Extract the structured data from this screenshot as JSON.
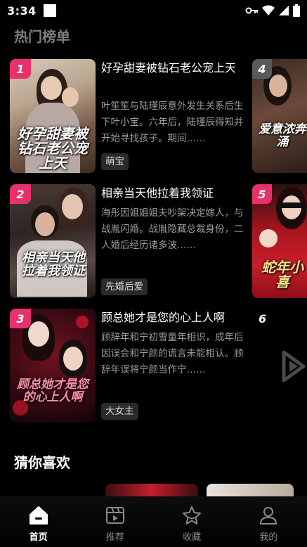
{
  "status_bar": {
    "time": "3:34"
  },
  "hot_section": {
    "title": "热门榜单"
  },
  "rank_items": [
    {
      "rank": "1",
      "title": "好孕甜妻被钻石老公宠上天",
      "description": "叶笙笙与陆瑾辰意外发生关系后生下叶小宝。六年后，陆瑾辰得知并开始寻找孩子。期间……",
      "tag": "萌宝",
      "poster_text": "好孕甜妻被钻石老公宠上天",
      "badge_color": "#e8316b"
    },
    {
      "rank": "2",
      "title": "相亲当天他拉着我领证",
      "description": "海彤因姐姐姐夫吵架决定嫁人，与战胤闪婚。战胤隐藏总裁身份，二人婚后经历诸多波……",
      "tag": "先婚后爱",
      "poster_text": "相亲当天他拉着我领证",
      "badge_color": "#e8316b"
    },
    {
      "rank": "3",
      "title": "顾总她才是您的心上人啊",
      "description": "顾辞年和宁初雪童年相识，成年后因误会和宁颜的谎言未能相认。顾辞年误将宁颜当作宁……",
      "tag": "大女主",
      "poster_text": "顾总她才是您的心上人啊",
      "badge_color": "#e8316b"
    }
  ],
  "side_items": [
    {
      "rank": "4",
      "poster_text": "爱意浓奔涌"
    },
    {
      "rank": "5",
      "poster_text": "蛇年小喜"
    },
    {
      "rank": "6"
    }
  ],
  "guess_section": {
    "title": "猜你喜欢"
  },
  "bottom_nav": [
    {
      "label": "首页",
      "icon": "home-icon",
      "active": true
    },
    {
      "label": "推荐",
      "icon": "clapperboard-icon",
      "active": false
    },
    {
      "label": "收藏",
      "icon": "star-icon",
      "active": false
    },
    {
      "label": "我的",
      "icon": "person-icon",
      "active": false
    }
  ],
  "colors": {
    "accent": "#e8316b",
    "background": "#000000",
    "muted_text": "#9a9a9a"
  }
}
